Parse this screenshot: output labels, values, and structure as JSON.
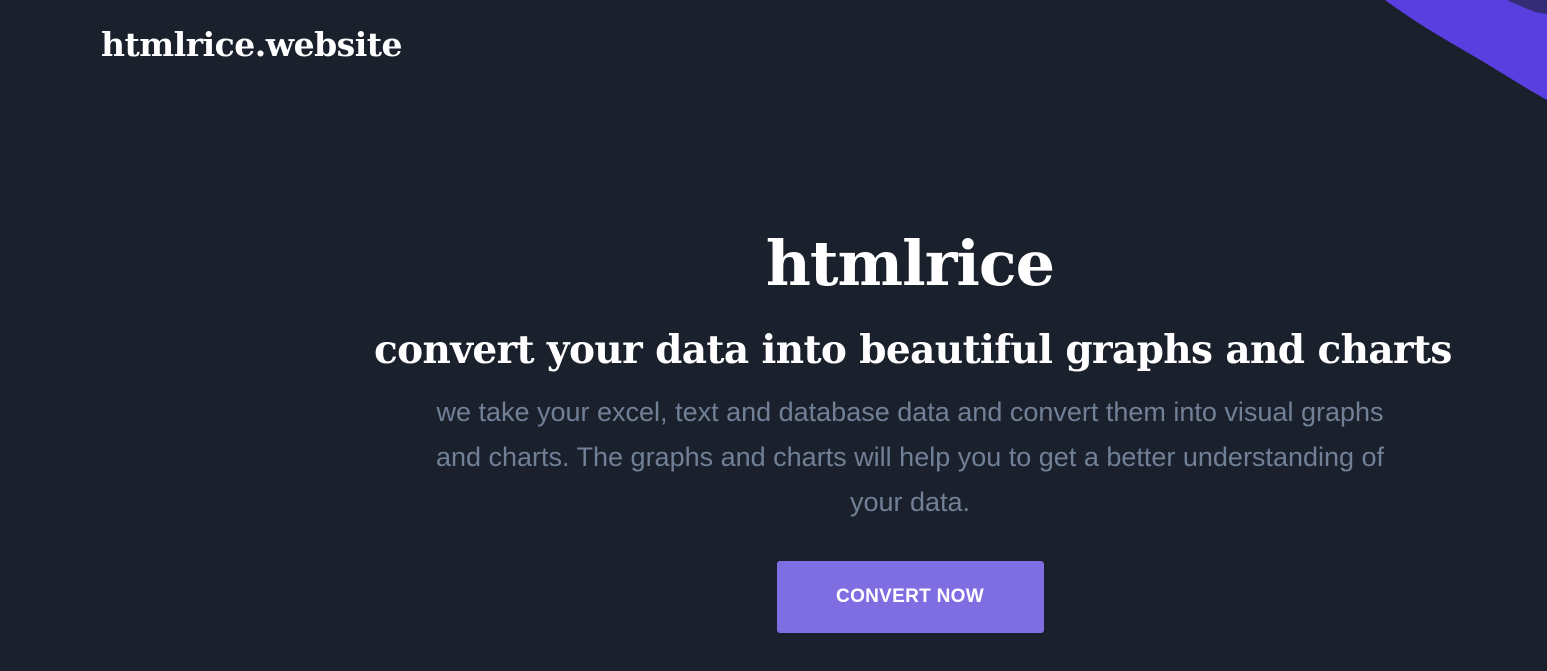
{
  "header": {
    "logo_text": "htmlrice.website"
  },
  "hero": {
    "title": "htmlrice",
    "subtitle": "convert your data into beautiful graphs and charts",
    "description": "we take your excel, text and database data and convert them into visual graphs and charts. The graphs and charts will help you to get a better understanding of your data.",
    "cta_label": "CONVERT NOW"
  },
  "colors": {
    "background": "#1a202c",
    "accent": "#7f6ee2",
    "blob": "#5a3fe0",
    "muted_text": "#718096"
  }
}
